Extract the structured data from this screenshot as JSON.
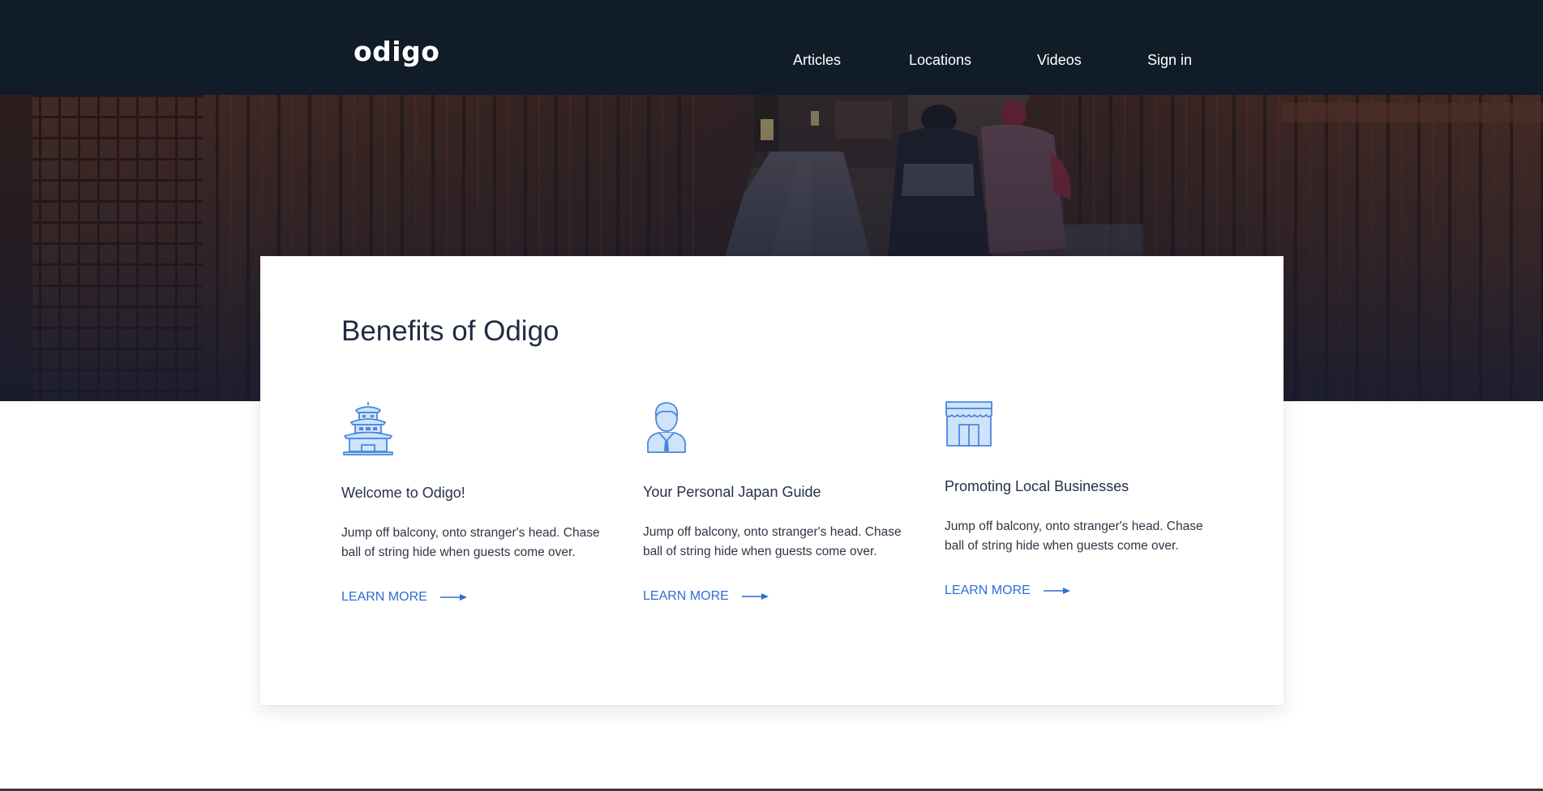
{
  "header": {
    "logo": "odigo",
    "nav": [
      {
        "label": "Articles"
      },
      {
        "label": "Locations"
      },
      {
        "label": "Videos"
      },
      {
        "label": "Sign in"
      }
    ]
  },
  "benefits": {
    "title": "Benefits of Odigo",
    "items": [
      {
        "icon": "pagoda-icon",
        "title": "Welcome to Odigo!",
        "text": "Jump off balcony, onto stranger's head. Chase ball of string hide when guests come over.",
        "link": "LEARN MORE"
      },
      {
        "icon": "person-icon",
        "title": "Your Personal Japan Guide",
        "text": "Jump off balcony, onto stranger's head. Chase ball of string hide when guests come over.",
        "link": "LEARN MORE"
      },
      {
        "icon": "shop-icon",
        "title": "Promoting Local Businesses",
        "text": "Jump off balcony, onto stranger's head. Chase ball of string hide when guests come over.",
        "link": "LEARN MORE"
      }
    ]
  },
  "colors": {
    "header_bg": "#101c28",
    "accent": "#2d6fd3",
    "icon_fill": "#cfe3fb",
    "icon_stroke": "#4a88dc",
    "heading": "#1f2b40"
  }
}
